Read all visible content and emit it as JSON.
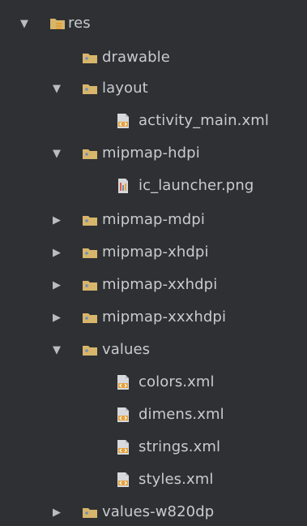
{
  "tree": {
    "root": {
      "label": "res",
      "expanded": true,
      "icon": "resource-folder-icon"
    },
    "items": [
      {
        "label": "drawable",
        "icon": "folder-icon",
        "expanded": null
      },
      {
        "label": "layout",
        "icon": "folder-icon",
        "expanded": true
      },
      {
        "label": "activity_main.xml",
        "icon": "xml-file-icon",
        "expanded": null
      },
      {
        "label": "mipmap-hdpi",
        "icon": "folder-icon",
        "expanded": true
      },
      {
        "label": "ic_launcher.png",
        "icon": "image-file-icon",
        "expanded": null
      },
      {
        "label": "mipmap-mdpi",
        "icon": "folder-icon",
        "expanded": false
      },
      {
        "label": "mipmap-xhdpi",
        "icon": "folder-icon",
        "expanded": false
      },
      {
        "label": "mipmap-xxhdpi",
        "icon": "folder-icon",
        "expanded": false
      },
      {
        "label": "mipmap-xxxhdpi",
        "icon": "folder-icon",
        "expanded": false
      },
      {
        "label": "values",
        "icon": "folder-icon",
        "expanded": true
      },
      {
        "label": "colors.xml",
        "icon": "xml-file-icon",
        "expanded": null
      },
      {
        "label": "dimens.xml",
        "icon": "xml-file-icon",
        "expanded": null
      },
      {
        "label": "strings.xml",
        "icon": "xml-file-icon",
        "expanded": null
      },
      {
        "label": "styles.xml",
        "icon": "xml-file-icon",
        "expanded": null
      },
      {
        "label": "values-w820dp",
        "icon": "folder-icon",
        "expanded": false
      }
    ]
  },
  "colors": {
    "background": "#2e3033",
    "text": "#c8cbcf",
    "folder": "#d7b56b",
    "folder_dot": "#6f8fb3",
    "xml_accent": "#e2a23f",
    "image_accent": "#7f90b6"
  }
}
